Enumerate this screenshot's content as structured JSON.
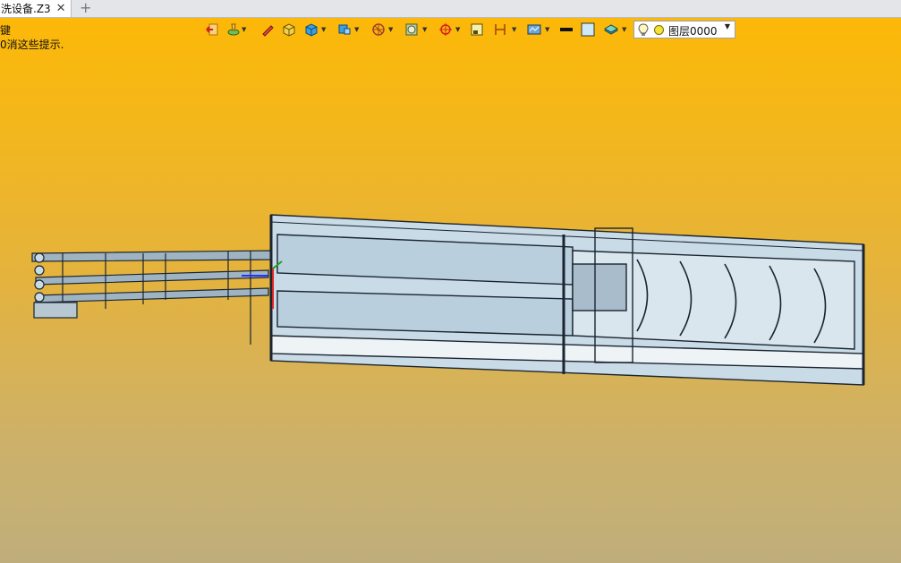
{
  "tab": {
    "title": "洗设备.Z3",
    "close_glyph": "✕",
    "add_glyph": "+"
  },
  "hints": {
    "line1": "键",
    "line2": "0消这些提示."
  },
  "toolbar": {
    "buttons": [
      {
        "icon": "exit-sketch-icon"
      },
      {
        "icon": "feature-paint-icon"
      },
      {
        "icon": "pen-edit-icon"
      },
      {
        "icon": "box-solid-icon"
      },
      {
        "icon": "shaded-cube-icon"
      },
      {
        "icon": "view-orientation-icon"
      },
      {
        "icon": "section-view-icon"
      },
      {
        "icon": "display-mode-icon"
      },
      {
        "icon": "snap-target-icon"
      },
      {
        "icon": "grid-icon"
      },
      {
        "icon": "dimension-icon"
      },
      {
        "icon": "render-settings-icon"
      },
      {
        "icon": "line-style-icon"
      },
      {
        "icon": "color-swatch-icon"
      },
      {
        "icon": "layer-stack-icon"
      }
    ],
    "layer_select": {
      "value": "图层0000",
      "arrow": "▼"
    }
  },
  "colors": {
    "viewport_top": "#fdb808",
    "viewport_bottom": "#bfae7b",
    "model_fill": "#c9dbe7",
    "model_line": "#1b2430"
  }
}
